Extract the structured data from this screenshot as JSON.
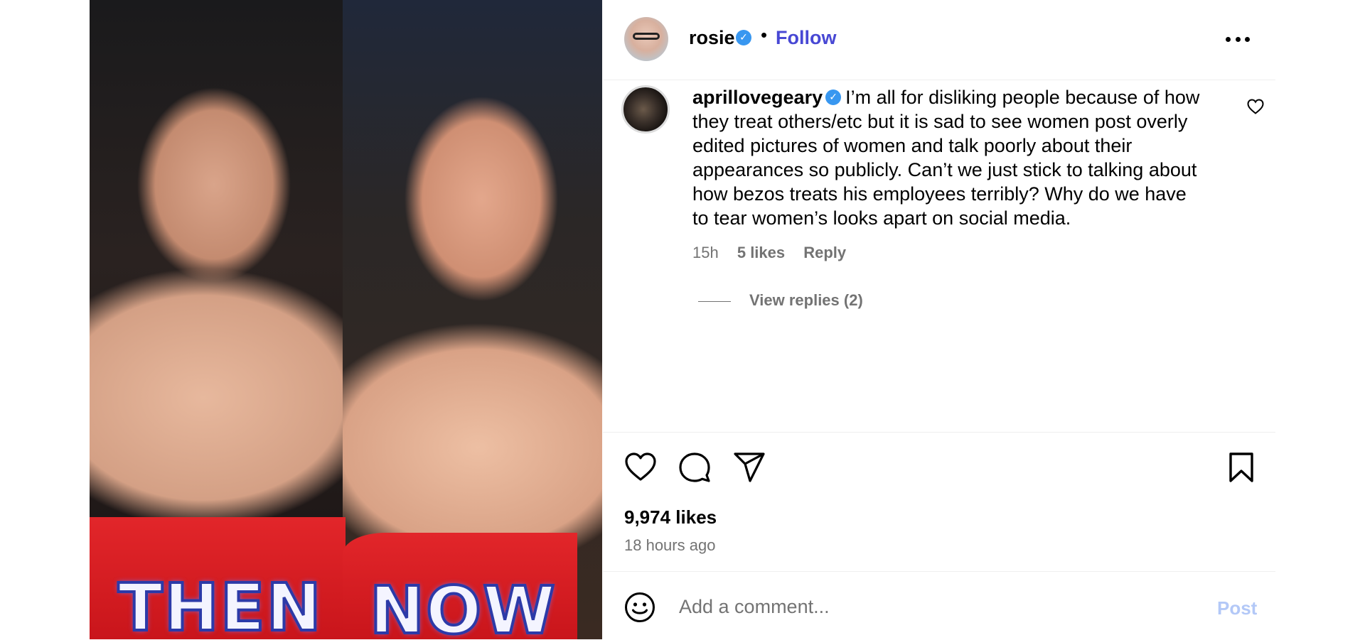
{
  "post_image": {
    "left_caption": "THEN",
    "right_caption": "NOW"
  },
  "header": {
    "username": "rosie",
    "verified_icon": "verified-badge-icon",
    "separator": "•",
    "follow_label": "Follow",
    "more_icon": "more-options-icon"
  },
  "comment": {
    "username": "aprillovegeary",
    "text": "I’m all for disliking people because of how they treat others/etc but it is sad to see women post overly edited pictures of women and talk poorly about their appearances so publicly. Can’t we just stick to talking about how bezos treats his employees terribly? Why do we have to tear women’s looks apart on social media.",
    "age": "15h",
    "likes": "5 likes",
    "reply_label": "Reply",
    "view_replies": "View replies (2)"
  },
  "actions": {
    "like_icon": "heart-icon",
    "comment_icon": "comment-icon",
    "share_icon": "share-icon",
    "save_icon": "bookmark-icon",
    "likes_count": "9,974 likes",
    "timestamp": "18 hours ago"
  },
  "composer": {
    "emoji_icon": "emoji-icon",
    "placeholder": "Add a comment...",
    "post_label": "Post"
  },
  "colors": {
    "follow": "#4848d4",
    "verified": "#3897f0",
    "muted": "#737373",
    "post_disabled": "#b3c8f7"
  }
}
